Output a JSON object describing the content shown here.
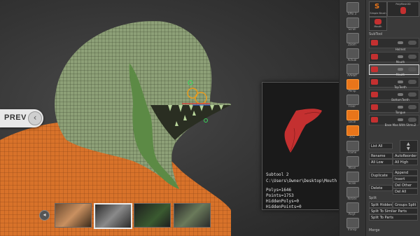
{
  "viewport": {
    "prev_label": "PREV",
    "prev_arrow": "‹",
    "thumbs_left_arrow": "◂",
    "thumbs_right_arrow": "▸",
    "thumbnails": [
      "thumb-1",
      "thumb-2",
      "thumb-3",
      "thumb-4"
    ]
  },
  "popup": {
    "line1": "Subtool 2",
    "line2": "C:\\Users\\Owner\\Desktop\\Mouth",
    "line3": "Polys=1646",
    "line4": "Points=1753",
    "line5": "HiddenPolys=0",
    "line6": "HiddenPoints=0"
  },
  "toolbar": {
    "items": [
      {
        "label": "SPix 3"
      },
      {
        "label": "Scroll"
      },
      {
        "label": "Zoom"
      },
      {
        "label": "Actual"
      },
      {
        "label": "AAHalf"
      },
      {
        "label": "Persp"
      },
      {
        "label": "Floor"
      },
      {
        "label": "Local"
      },
      {
        "label": "XYZ"
      },
      {
        "label": "Frame"
      },
      {
        "label": "Move"
      },
      {
        "label": "Scale"
      },
      {
        "label": "Rotate"
      },
      {
        "label": "PolyF"
      },
      {
        "label": "Transp"
      },
      {
        "label": "Solo"
      },
      {
        "label": "Xpose"
      }
    ]
  },
  "palette": {
    "top_items": [
      {
        "label": "Simple Brush"
      },
      {
        "label": "PolyMesh3D"
      },
      {
        "label": "Mouth"
      }
    ],
    "subtool_header": "SubTool",
    "subtools": [
      {
        "name": "Helmet"
      },
      {
        "name": "Mouth"
      },
      {
        "name": "Mouth"
      },
      {
        "name": "Teeth"
      },
      {
        "name": "TopTeeth"
      },
      {
        "name": "BottomTeeth"
      },
      {
        "name": "Tongue"
      },
      {
        "name": "Base Mas With Shmu2"
      }
    ],
    "list_all": "List All",
    "rename": "Rename",
    "autoreorder": "AutoReorder",
    "all_low": "All Low",
    "all_high": "All High",
    "duplicate": "Duplicate",
    "append": "Append",
    "insert": "Insert",
    "del_other": "Del Other",
    "delete": "Delete",
    "del_all": "Del All",
    "split_header": "Split",
    "split_hidden": "Split Hidden",
    "groups_split": "Groups Split",
    "split_similar": "Split To Similar Parts",
    "split_parts": "Split To Parts",
    "merge_header": "Merge",
    "accent_color": "#e8751a"
  }
}
